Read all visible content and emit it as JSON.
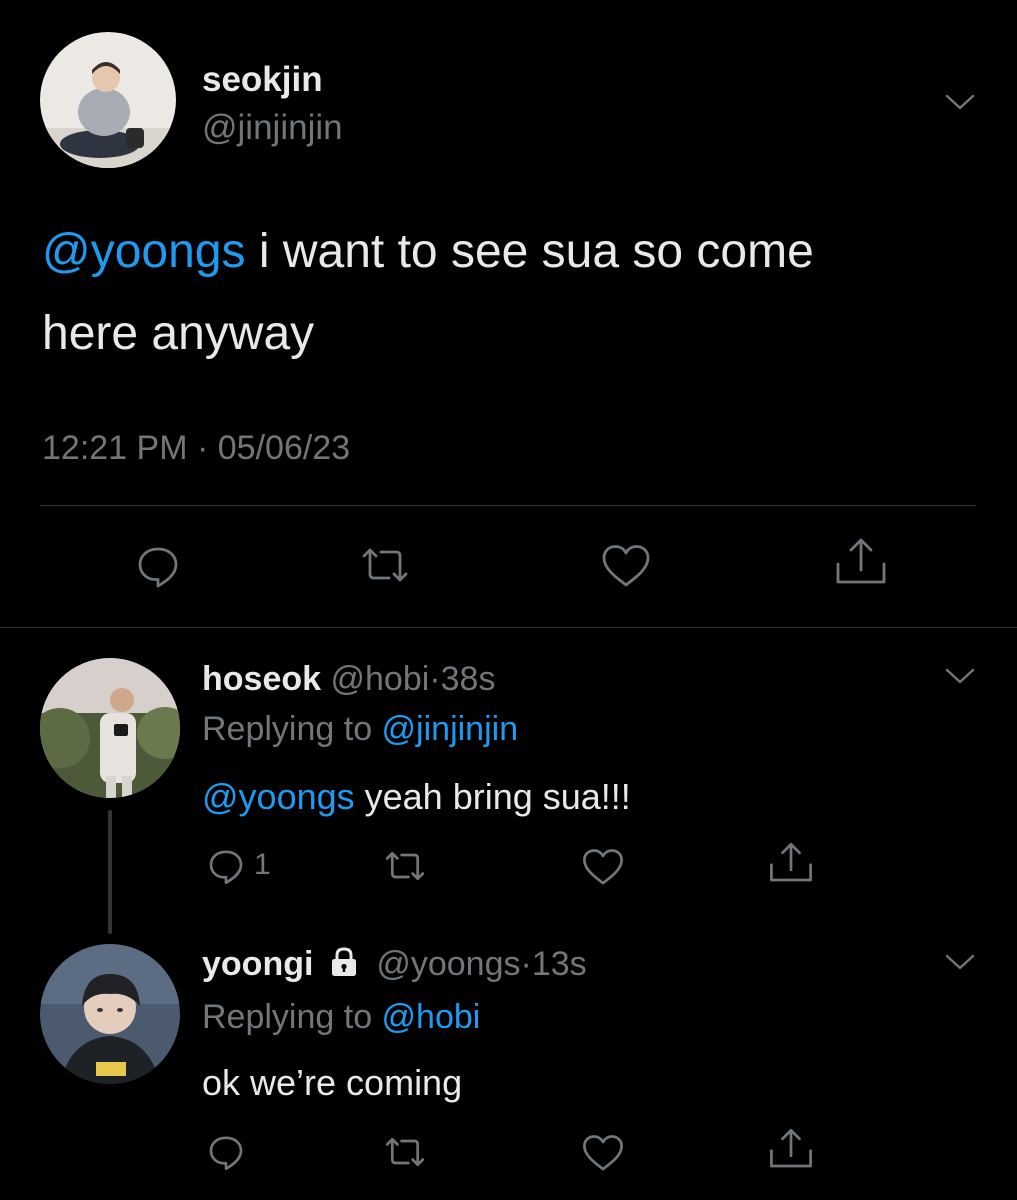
{
  "main_tweet": {
    "display_name": "seokjin",
    "handle": "@jinjinjin",
    "mention": "@yoongs",
    "text_line1": " i want to see sua so come",
    "text_line2": "here anyway",
    "time": "12:21 PM",
    "separator": "·",
    "date": "05/06/23"
  },
  "replies": [
    {
      "display_name": "hoseok",
      "handle": "@hobi",
      "separator": "·",
      "age": "38s",
      "replying_prefix": "Replying to ",
      "replying_handle": "@jinjinjin",
      "mention": "@yoongs",
      "text": " yeah bring sua!!!",
      "reply_count": "1"
    },
    {
      "display_name": "yoongi",
      "locked": true,
      "handle": "@yoongs",
      "separator": "·",
      "age": "13s",
      "replying_prefix": "Replying to ",
      "replying_handle": "@hobi",
      "text": "ok we’re coming",
      "reply_count": ""
    }
  ],
  "icons": {
    "reply": "speech-bubble",
    "retweet": "retweet-arrows",
    "like": "heart",
    "share": "share-up-arrow",
    "more": "chevron-down",
    "lock": "padlock"
  },
  "colors": {
    "background": "#000000",
    "text": "#e7e9ea",
    "muted": "#71767b",
    "link": "#1d9bf0",
    "divider": "#2f3336"
  }
}
